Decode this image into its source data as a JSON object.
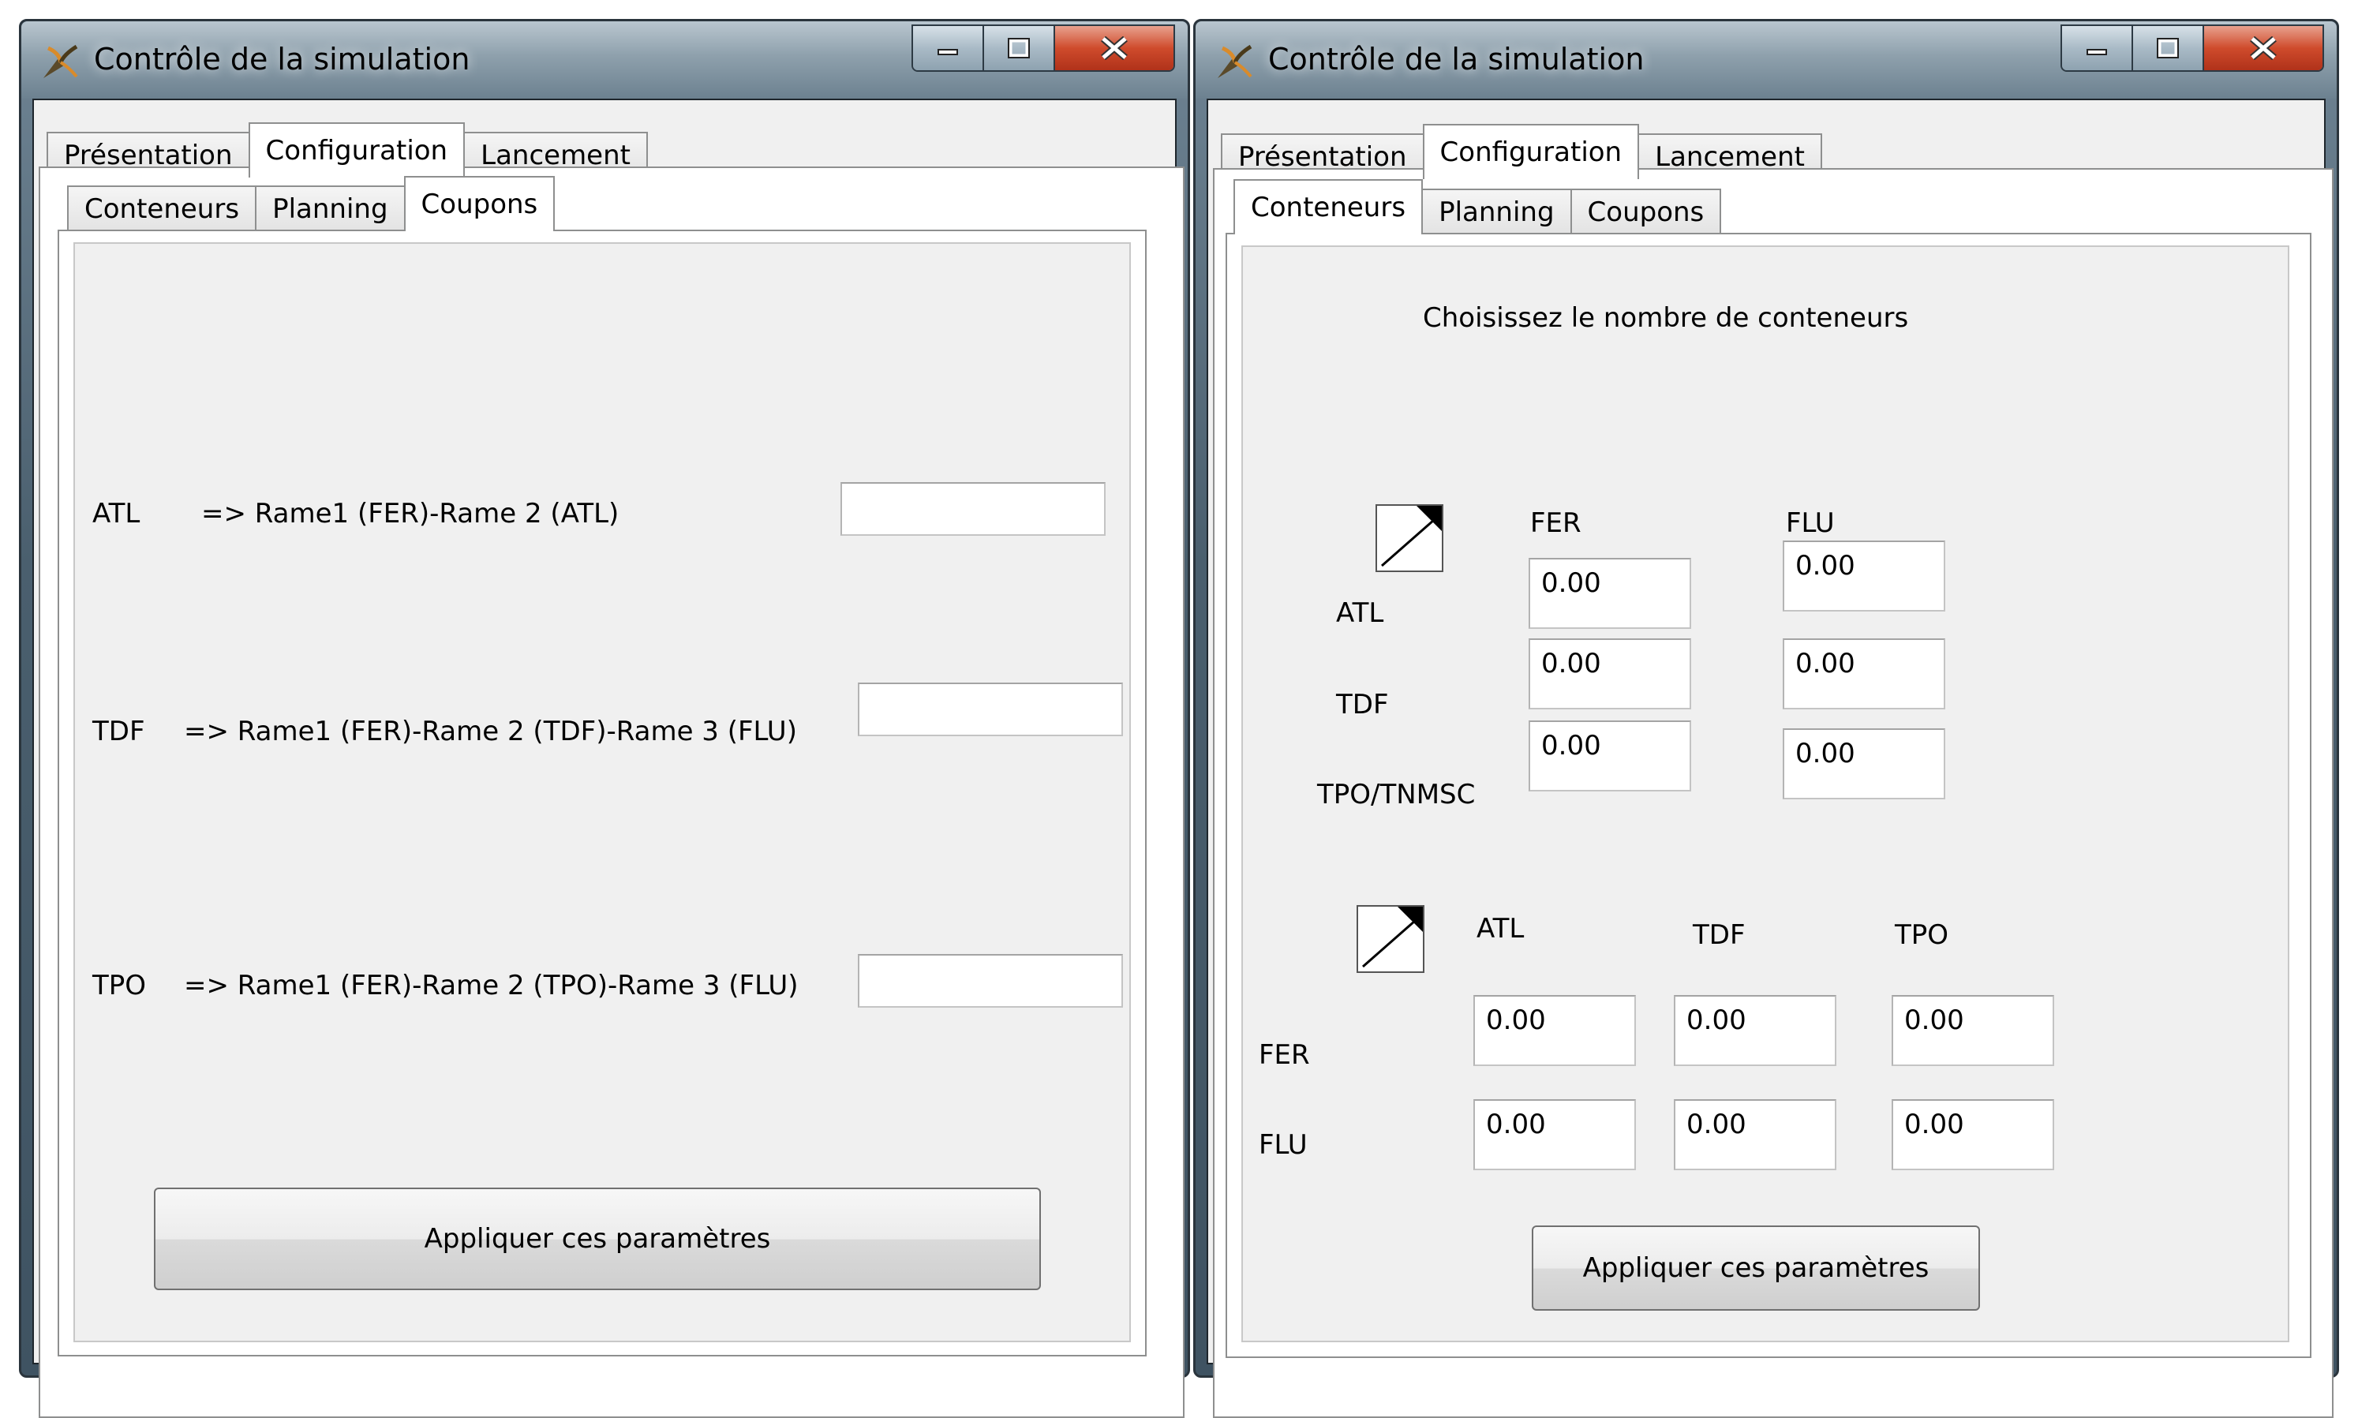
{
  "window_title": "Contrôle de la simulation",
  "main_tabs": [
    "Présentation",
    "Configuration",
    "Lancement"
  ],
  "sub_tabs": [
    "Conteneurs",
    "Planning",
    "Coupons"
  ],
  "apply_label": "Appliquer ces paramètres",
  "left": {
    "rows": [
      {
        "code": "ATL",
        "route": "=> Rame1 (FER)-Rame 2 (ATL)",
        "value": ""
      },
      {
        "code": "TDF",
        "route": "=> Rame1 (FER)-Rame 2 (TDF)-Rame 3 (FLU)",
        "value": ""
      },
      {
        "code": "TPO",
        "route": "=> Rame1 (FER)-Rame 2 (TPO)-Rame 3 (FLU)",
        "value": ""
      }
    ]
  },
  "right": {
    "heading": "Choisissez le nombre de conteneurs",
    "grid1": {
      "cols": [
        "FER",
        "FLU"
      ],
      "rows": [
        "ATL",
        "TDF",
        "TPO/TNMSC"
      ],
      "values": [
        [
          "0.00",
          "0.00"
        ],
        [
          "0.00",
          "0.00"
        ],
        [
          "0.00",
          "0.00"
        ]
      ]
    },
    "grid2": {
      "cols": [
        "ATL",
        "TDF",
        "TPO"
      ],
      "rows": [
        "FER",
        "FLU"
      ],
      "values": [
        [
          "0.00",
          "0.00",
          "0.00"
        ],
        [
          "0.00",
          "0.00",
          "0.00"
        ]
      ]
    }
  }
}
